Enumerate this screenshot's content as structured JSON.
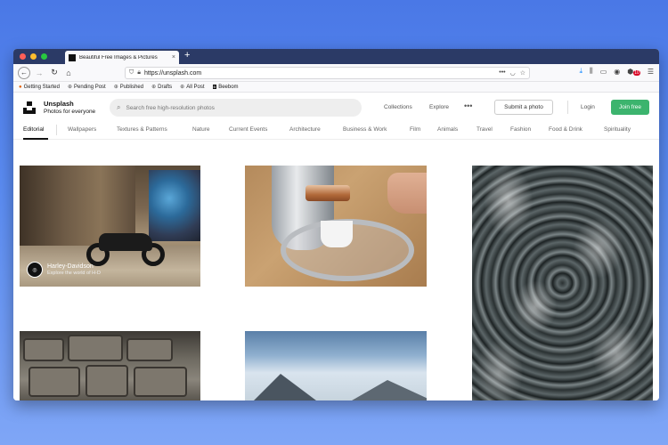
{
  "browser": {
    "tab_title": "Beautiful Free Images & Pictures",
    "tab_close": "×",
    "new_tab": "+",
    "url": "https://unsplash.com",
    "bookmarks": [
      {
        "label": "Getting Started",
        "icon": "firefox-icon"
      },
      {
        "label": "Pending Post",
        "icon": "globe-icon"
      },
      {
        "label": "Published",
        "icon": "globe-icon"
      },
      {
        "label": "Drafts",
        "icon": "globe-icon"
      },
      {
        "label": "All Post",
        "icon": "globe-icon"
      },
      {
        "label": "Beebom",
        "icon": "beebom-icon"
      }
    ],
    "badge_count": "10"
  },
  "header": {
    "brand_name": "Unsplash",
    "brand_tagline": "Photos for everyone",
    "search_placeholder": "Search free high-resolution photos",
    "collections": "Collections",
    "explore": "Explore",
    "more": "•••",
    "submit": "Submit a photo",
    "login": "Login",
    "join": "Join free",
    "accent": "#3cb46e"
  },
  "categories": [
    "Editorial",
    "Wallpapers",
    "Textures & Patterns",
    "Nature",
    "Current Events",
    "Architecture",
    "Business & Work",
    "Film",
    "Animals",
    "Travel",
    "Fashion",
    "Food & Drink",
    "Spirituality"
  ],
  "photos": {
    "moto_title": "Harley-Davidson",
    "moto_sub": "Explore the world of H-D"
  }
}
